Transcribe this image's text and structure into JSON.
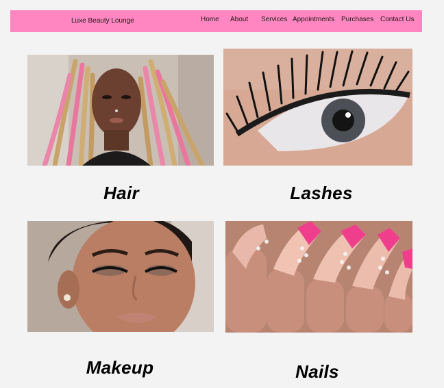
{
  "navbar": {
    "brand": "Luxe Beauty Lounge",
    "links": [
      "Home",
      "About",
      "Services",
      "Appointments",
      "Purchases",
      "Contact Us"
    ]
  },
  "services": [
    {
      "title": "Hair",
      "image_subject": "braided hair portrait with pink and blonde braids"
    },
    {
      "title": "Lashes",
      "image_subject": "close-up of eyelash extensions"
    },
    {
      "title": "Makeup",
      "image_subject": "glam makeup portrait"
    },
    {
      "title": "Nails",
      "image_subject": "long nude acrylic nails with pink rhinestone tips"
    }
  ],
  "colors": {
    "navbar": "#ff86c0",
    "background": "#f3f3f3",
    "text": "#000000"
  }
}
